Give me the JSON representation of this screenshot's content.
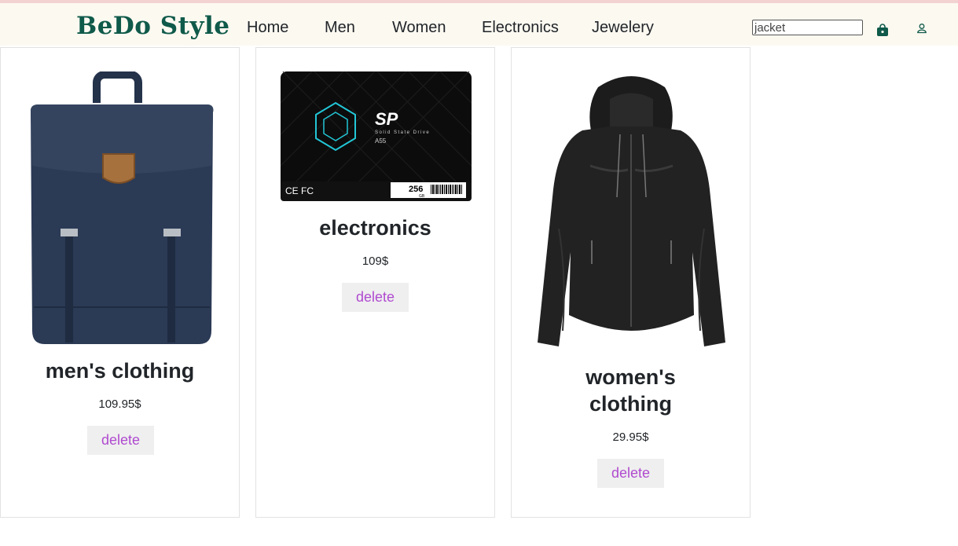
{
  "header": {
    "brand": "BeDo Style",
    "nav": [
      "Home",
      "Men",
      "Women",
      "Electronics",
      "Jewelery"
    ],
    "search_value": "jacket",
    "cart_icon": "shopping-bag-icon",
    "user_icon": "user-icon"
  },
  "colors": {
    "brand": "#0f5a4a",
    "navbar_bg": "#fcf9f1",
    "delete_text": "#b04bd0",
    "delete_bg": "#efefef"
  },
  "products": [
    {
      "title": "men's clothing",
      "price": "109.95$",
      "delete_label": "delete",
      "image": "navy-backpack"
    },
    {
      "title": "electronics",
      "price": "109$",
      "delete_label": "delete",
      "image": "ssd-drive",
      "image_text": {
        "brand": "SP",
        "line": "Solid State Drive",
        "model": "A55",
        "capacity": "256",
        "unit": "GB"
      }
    },
    {
      "title": "women's clothing",
      "price": "29.95$",
      "delete_label": "delete",
      "image": "black-leather-jacket"
    }
  ]
}
